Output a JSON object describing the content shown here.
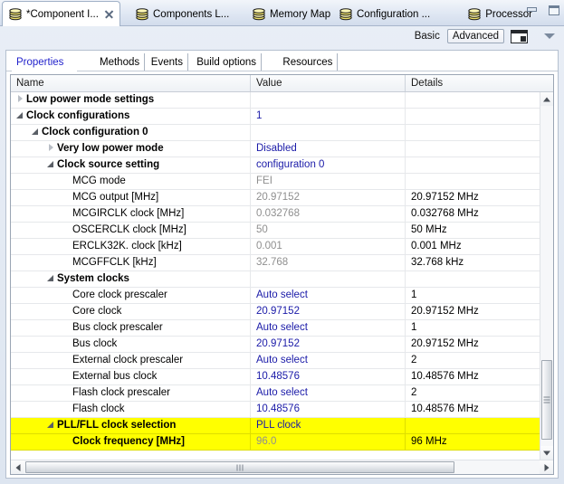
{
  "window": {
    "minimize_label": "minimize",
    "maximize_label": "maximize"
  },
  "editor_tabs": [
    {
      "label": "*Component I...",
      "icon": "component-icon",
      "active": true,
      "closable": true
    },
    {
      "label": "Components L...",
      "icon": "component-icon",
      "active": false,
      "closable": false
    },
    {
      "label": "Memory Map",
      "icon": "component-icon",
      "active": false,
      "closable": false
    },
    {
      "label": "Configuration ...",
      "icon": "component-icon",
      "active": false,
      "closable": false
    },
    {
      "label": "Processor",
      "icon": "component-icon",
      "active": false,
      "closable": false
    }
  ],
  "toolbar": {
    "basic_label": "Basic",
    "advanced_label": "Advanced",
    "advanced_selected": true,
    "panel_icon": "show-panel-icon",
    "view_menu_icon": "view-menu-chevron-icon"
  },
  "inner_tabs": [
    {
      "label": "Properties",
      "selected": true
    },
    {
      "label": "Methods",
      "selected": false
    },
    {
      "label": "Events",
      "selected": false
    },
    {
      "label": "Build options",
      "selected": false
    },
    {
      "label": "Resources",
      "selected": false
    }
  ],
  "table": {
    "columns": [
      "Name",
      "Value",
      "Details"
    ],
    "rows": [
      {
        "indent": 0,
        "expander": "collapsed",
        "bold": true,
        "name": "Low power mode settings",
        "value": "",
        "value_style": "link",
        "details": "",
        "highlight": false
      },
      {
        "indent": 0,
        "expander": "expanded",
        "bold": true,
        "name": "Clock configurations",
        "value": "1",
        "value_style": "link",
        "details": "",
        "highlight": false
      },
      {
        "indent": 1,
        "expander": "expanded",
        "bold": true,
        "name": "Clock configuration 0",
        "value": "",
        "value_style": "link",
        "details": "",
        "highlight": false
      },
      {
        "indent": 2,
        "expander": "collapsed",
        "bold": true,
        "name": "Very low power mode",
        "value": "Disabled",
        "value_style": "link",
        "details": "",
        "highlight": false
      },
      {
        "indent": 2,
        "expander": "expanded",
        "bold": true,
        "name": "Clock source setting",
        "value": "configuration 0",
        "value_style": "link",
        "details": "",
        "highlight": false
      },
      {
        "indent": 3,
        "expander": "none",
        "bold": false,
        "name": "MCG mode",
        "value": "FEI",
        "value_style": "gray",
        "details": "",
        "highlight": false
      },
      {
        "indent": 3,
        "expander": "none",
        "bold": false,
        "name": "MCG output [MHz]",
        "value": "20.97152",
        "value_style": "gray",
        "details": "20.97152 MHz",
        "highlight": false
      },
      {
        "indent": 3,
        "expander": "none",
        "bold": false,
        "name": "MCGIRCLK clock [MHz]",
        "value": "0.032768",
        "value_style": "gray",
        "details": "0.032768 MHz",
        "highlight": false
      },
      {
        "indent": 3,
        "expander": "none",
        "bold": false,
        "name": "OSCERCLK clock [MHz]",
        "value": "50",
        "value_style": "gray",
        "details": "50 MHz",
        "highlight": false
      },
      {
        "indent": 3,
        "expander": "none",
        "bold": false,
        "name": "ERCLK32K. clock [kHz]",
        "value": "0.001",
        "value_style": "gray",
        "details": "0.001 MHz",
        "highlight": false
      },
      {
        "indent": 3,
        "expander": "none",
        "bold": false,
        "name": "MCGFFCLK [kHz]",
        "value": "32.768",
        "value_style": "gray",
        "details": "32.768 kHz",
        "highlight": false
      },
      {
        "indent": 2,
        "expander": "expanded",
        "bold": true,
        "name": "System clocks",
        "value": "",
        "value_style": "link",
        "details": "",
        "highlight": false
      },
      {
        "indent": 3,
        "expander": "none",
        "bold": false,
        "name": "Core clock prescaler",
        "value": "Auto select",
        "value_style": "link",
        "details": "1",
        "highlight": false
      },
      {
        "indent": 3,
        "expander": "none",
        "bold": false,
        "name": "Core clock",
        "value": "20.97152",
        "value_style": "link",
        "details": "20.97152 MHz",
        "highlight": false
      },
      {
        "indent": 3,
        "expander": "none",
        "bold": false,
        "name": "Bus clock prescaler",
        "value": "Auto select",
        "value_style": "link",
        "details": "1",
        "highlight": false
      },
      {
        "indent": 3,
        "expander": "none",
        "bold": false,
        "name": "Bus clock",
        "value": "20.97152",
        "value_style": "link",
        "details": "20.97152 MHz",
        "highlight": false
      },
      {
        "indent": 3,
        "expander": "none",
        "bold": false,
        "name": "External clock prescaler",
        "value": "Auto select",
        "value_style": "link",
        "details": "2",
        "highlight": false
      },
      {
        "indent": 3,
        "expander": "none",
        "bold": false,
        "name": "External bus clock",
        "value": "10.48576",
        "value_style": "link",
        "details": "10.48576 MHz",
        "highlight": false
      },
      {
        "indent": 3,
        "expander": "none",
        "bold": false,
        "name": "Flash clock prescaler",
        "value": "Auto select",
        "value_style": "link",
        "details": "2",
        "highlight": false
      },
      {
        "indent": 3,
        "expander": "none",
        "bold": false,
        "name": "Flash clock",
        "value": "10.48576",
        "value_style": "link",
        "details": "10.48576 MHz",
        "highlight": false
      },
      {
        "indent": 2,
        "expander": "expanded",
        "bold": true,
        "name": "PLL/FLL clock selection",
        "value": "PLL clock",
        "value_style": "link",
        "details": "",
        "highlight": true
      },
      {
        "indent": 3,
        "expander": "none",
        "bold": true,
        "name": "Clock frequency [MHz]",
        "value": "96.0",
        "value_style": "gray",
        "details": "96 MHz",
        "highlight": true
      }
    ]
  },
  "scrollbars": {
    "vertical_up_icon": "scroll-up-arrow-icon",
    "vertical_down_icon": "scroll-down-arrow-icon",
    "horizontal_left_icon": "scroll-left-arrow-icon",
    "horizontal_right_icon": "scroll-right-arrow-icon"
  },
  "colors": {
    "highlight": "#ffff00",
    "link": "#1a1aa8",
    "readonly": "#8f8f8f",
    "selected_tab_text": "#2222cc"
  }
}
